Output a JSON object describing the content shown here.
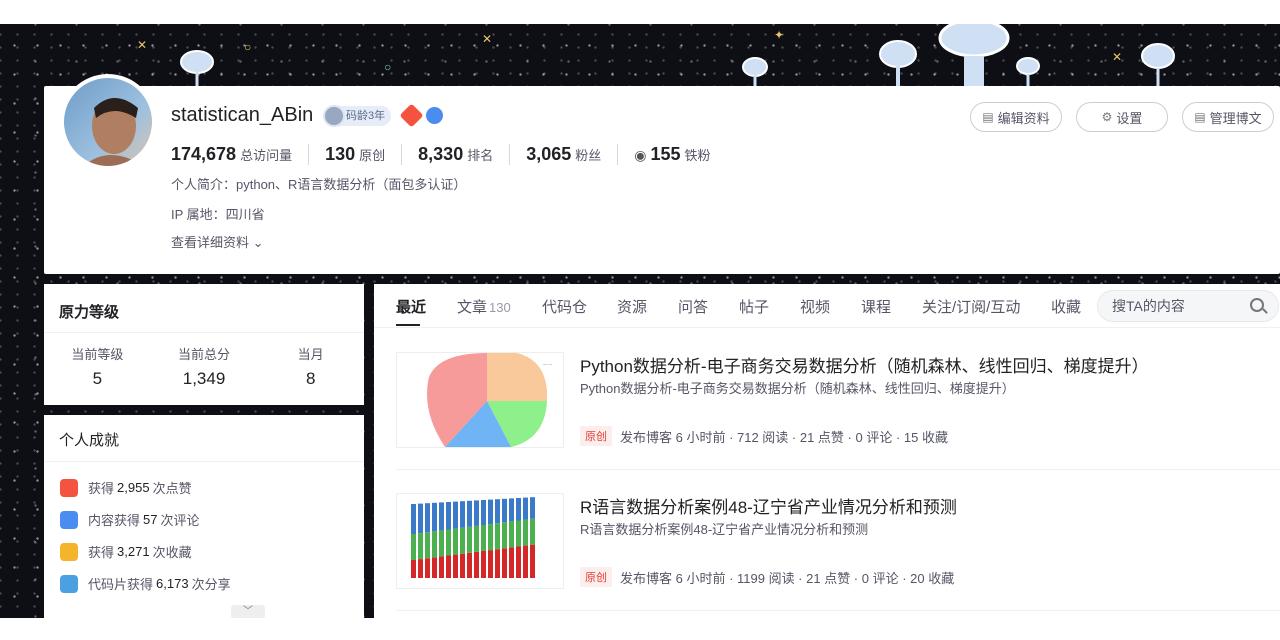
{
  "profile": {
    "username": "statistican_ABin",
    "code_age": "码龄3年",
    "stats": [
      {
        "num": "174,678",
        "label": "总访问量"
      },
      {
        "num": "130",
        "label": "原创"
      },
      {
        "num": "8,330",
        "label": "排名"
      },
      {
        "num": "3,065",
        "label": "粉丝"
      },
      {
        "num": "155",
        "label": "铁粉"
      }
    ],
    "intro": "个人简介：python、R语言数据分析（面包多认证）",
    "ip": "IP 属地：四川省",
    "detail_link": "查看详细资料",
    "buttons": {
      "edit": "编辑资料",
      "settings": "设置",
      "manage": "管理博文"
    }
  },
  "level": {
    "title": "原力等级",
    "items": [
      {
        "label": "当前等级",
        "value": "5"
      },
      {
        "label": "当前总分",
        "value": "1,349"
      },
      {
        "label": "当月",
        "value": "8"
      }
    ]
  },
  "achievements": {
    "title": "个人成就",
    "items": [
      {
        "pre": "获得",
        "num": "2,955",
        "post": "次点赞",
        "color": "#f4533f"
      },
      {
        "pre": "内容获得",
        "num": "57",
        "post": "次评论",
        "color": "#4a8cf0"
      },
      {
        "pre": "获得",
        "num": "3,271",
        "post": "次收藏",
        "color": "#f5b52a"
      },
      {
        "pre": "代码片获得",
        "num": "6,173",
        "post": "次分享",
        "color": "#4aa0e0"
      }
    ]
  },
  "tabs": {
    "items": [
      "最近",
      "文章",
      "代码仓",
      "资源",
      "问答",
      "帖子",
      "视频",
      "课程",
      "关注/订阅/互动",
      "收藏"
    ],
    "article_count": "130",
    "search_placeholder": "搜TA的内容"
  },
  "articles": [
    {
      "title": "Python数据分析-电子商务交易数据分析（随机森林、线性回归、梯度提升）",
      "desc": "Python数据分析-电子商务交易数据分析（随机森林、线性回归、梯度提升）",
      "tag": "原创",
      "meta": "发布博客 6 小时前 ·  712 阅读 ·  21 点赞 ·  0 评论 ·  15 收藏"
    },
    {
      "title": "R语言数据分析案例48-辽宁省产业情况分析和预测",
      "desc": "R语言数据分析案例48-辽宁省产业情况分析和预测",
      "tag": "原创",
      "meta": "发布博客 6 小时前 ·  1199 阅读 ·  21 点赞 ·  0 评论 ·  20 收藏"
    }
  ]
}
